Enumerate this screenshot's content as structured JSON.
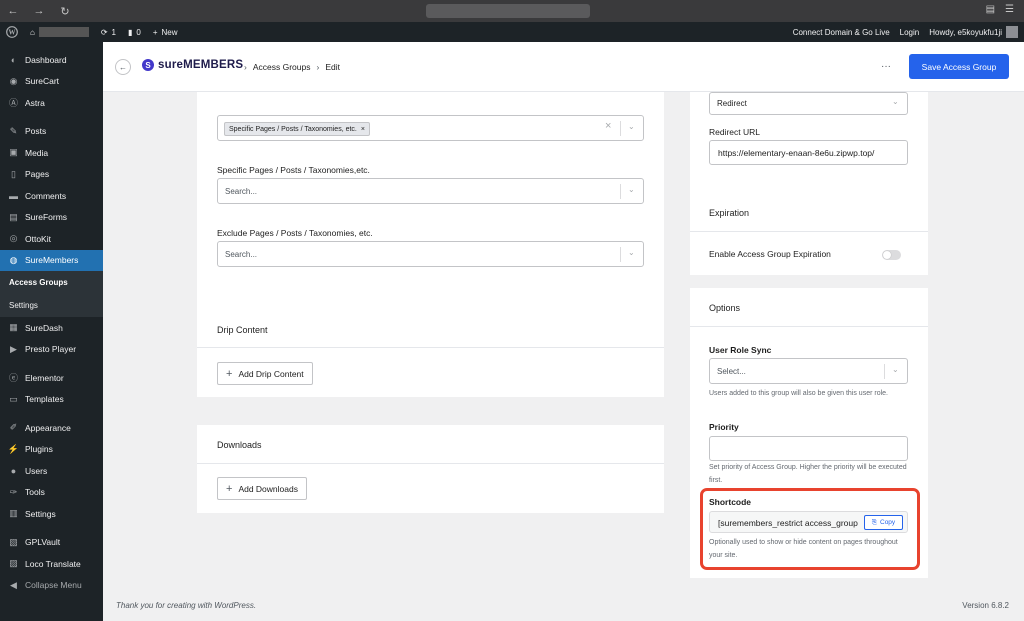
{
  "browser": {
    "back": "←",
    "forward": "→",
    "reload": "↻"
  },
  "adminbar": {
    "comments_count": "1",
    "updates_count": "0",
    "new_label": "New",
    "connect_domain": "Connect Domain & Go Live",
    "login": "Login",
    "howdy": "Howdy, e5koyukfu1ji"
  },
  "sidebar": {
    "items": [
      {
        "label": "Dashboard",
        "icon": "dashboard-icon"
      },
      {
        "label": "SureCart",
        "icon": "surecart-icon"
      },
      {
        "label": "Astra",
        "icon": "astra-icon"
      },
      {
        "label": "Posts",
        "icon": "pin-icon"
      },
      {
        "label": "Media",
        "icon": "media-icon"
      },
      {
        "label": "Pages",
        "icon": "page-icon"
      },
      {
        "label": "Comments",
        "icon": "comment-icon"
      },
      {
        "label": "SureForms",
        "icon": "form-icon"
      },
      {
        "label": "OttoKit",
        "icon": "ottokit-icon"
      },
      {
        "label": "SureMembers",
        "icon": "suremembers-icon"
      },
      {
        "label": "SureDash",
        "icon": "suredash-icon"
      },
      {
        "label": "Presto Player",
        "icon": "play-icon"
      },
      {
        "label": "Elementor",
        "icon": "elementor-icon"
      },
      {
        "label": "Templates",
        "icon": "folder-icon"
      },
      {
        "label": "Appearance",
        "icon": "brush-icon"
      },
      {
        "label": "Plugins",
        "icon": "plugin-icon"
      },
      {
        "label": "Users",
        "icon": "user-icon"
      },
      {
        "label": "Tools",
        "icon": "wrench-icon"
      },
      {
        "label": "Settings",
        "icon": "settings-icon"
      },
      {
        "label": "GPLVault",
        "icon": "vault-icon"
      },
      {
        "label": "Loco Translate",
        "icon": "translate-icon"
      },
      {
        "label": "Collapse Menu",
        "icon": "collapse-icon"
      }
    ],
    "submenu": [
      "Access Groups",
      "Settings"
    ]
  },
  "header": {
    "logo_text": "sureMEMBERS",
    "breadcrumb": [
      "Access Groups",
      "Edit"
    ],
    "more": "···",
    "save_button": "Save Access Group"
  },
  "content": {
    "selected_chip": "Specific Pages / Posts / Taxonomies, etc.",
    "specific_label": "Specific Pages / Posts / Taxonomies,etc.",
    "specific_placeholder": "Search...",
    "exclude_label": "Exclude Pages / Posts / Taxonomies, etc.",
    "exclude_placeholder": "Search...",
    "drip_title": "Drip Content",
    "drip_button": "Add Drip Content",
    "downloads_title": "Downloads",
    "downloads_button": "Add Downloads"
  },
  "right": {
    "redirect_select": "Redirect",
    "redirect_url_label": "Redirect URL",
    "redirect_url_value": "https://elementary-enaan-8e6u.zipwp.top/",
    "expiration_title": "Expiration",
    "expiration_toggle_label": "Enable Access Group Expiration",
    "expiration_enabled": false,
    "options_title": "Options",
    "role_sync_label": "User Role Sync",
    "role_sync_placeholder": "Select...",
    "role_sync_help": "Users added to this group will also be given this user role.",
    "priority_label": "Priority",
    "priority_value": "",
    "priority_help": "Set priority of Access Group. Higher the priority will be executed first.",
    "shortcode_label": "Shortcode",
    "shortcode_value": "[suremembers_restrict access_group",
    "copy_button": "Copy",
    "shortcode_help": "Optionally used to show or hide content on pages throughout your site."
  },
  "footer": {
    "thanks": "Thank you for creating with WordPress.",
    "version": "Version 6.8.2"
  },
  "colors": {
    "primary": "#2563eb",
    "wp_active": "#2271b1",
    "highlight": "#e8432e",
    "sidebar_bg": "#1d2327"
  }
}
